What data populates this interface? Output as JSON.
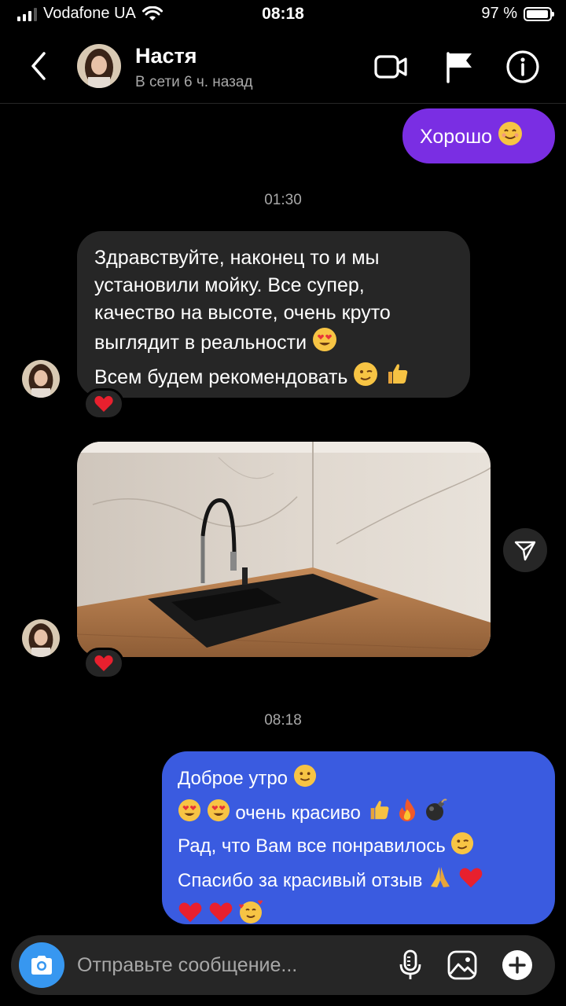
{
  "status_bar": {
    "carrier": "Vodafone UA",
    "time": "08:18",
    "battery": "97 %"
  },
  "header": {
    "name": "Настя",
    "status": "В сети 6 ч. назад"
  },
  "messages": {
    "out_1": "Хорошо",
    "timestamp_1": "01:30",
    "in_1_lines": [
      "Здравствуйте, наконец то и мы",
      "установили мойку. Все супер,",
      "качество на высоте, очень круто",
      "выглядит в реальности",
      "Всем будем рекомендовать"
    ],
    "timestamp_2": "08:18",
    "out_2_lines": [
      "Доброе утро",
      "очень красиво",
      "Рад, что Вам все понравилось",
      "Спасибо за красивый отзыв"
    ]
  },
  "composer": {
    "placeholder": "Отправьте сообщение..."
  },
  "colors": {
    "out_purple": "#7a2ee3",
    "out_blue": "#3a5be0",
    "incoming": "#262626",
    "accent": "#3797f0"
  },
  "icons": [
    "back-chevron-icon",
    "video-call-icon",
    "flag-icon",
    "info-icon",
    "share-icon",
    "camera-icon",
    "microphone-icon",
    "gallery-icon",
    "plus-icon",
    "heart-icon"
  ]
}
